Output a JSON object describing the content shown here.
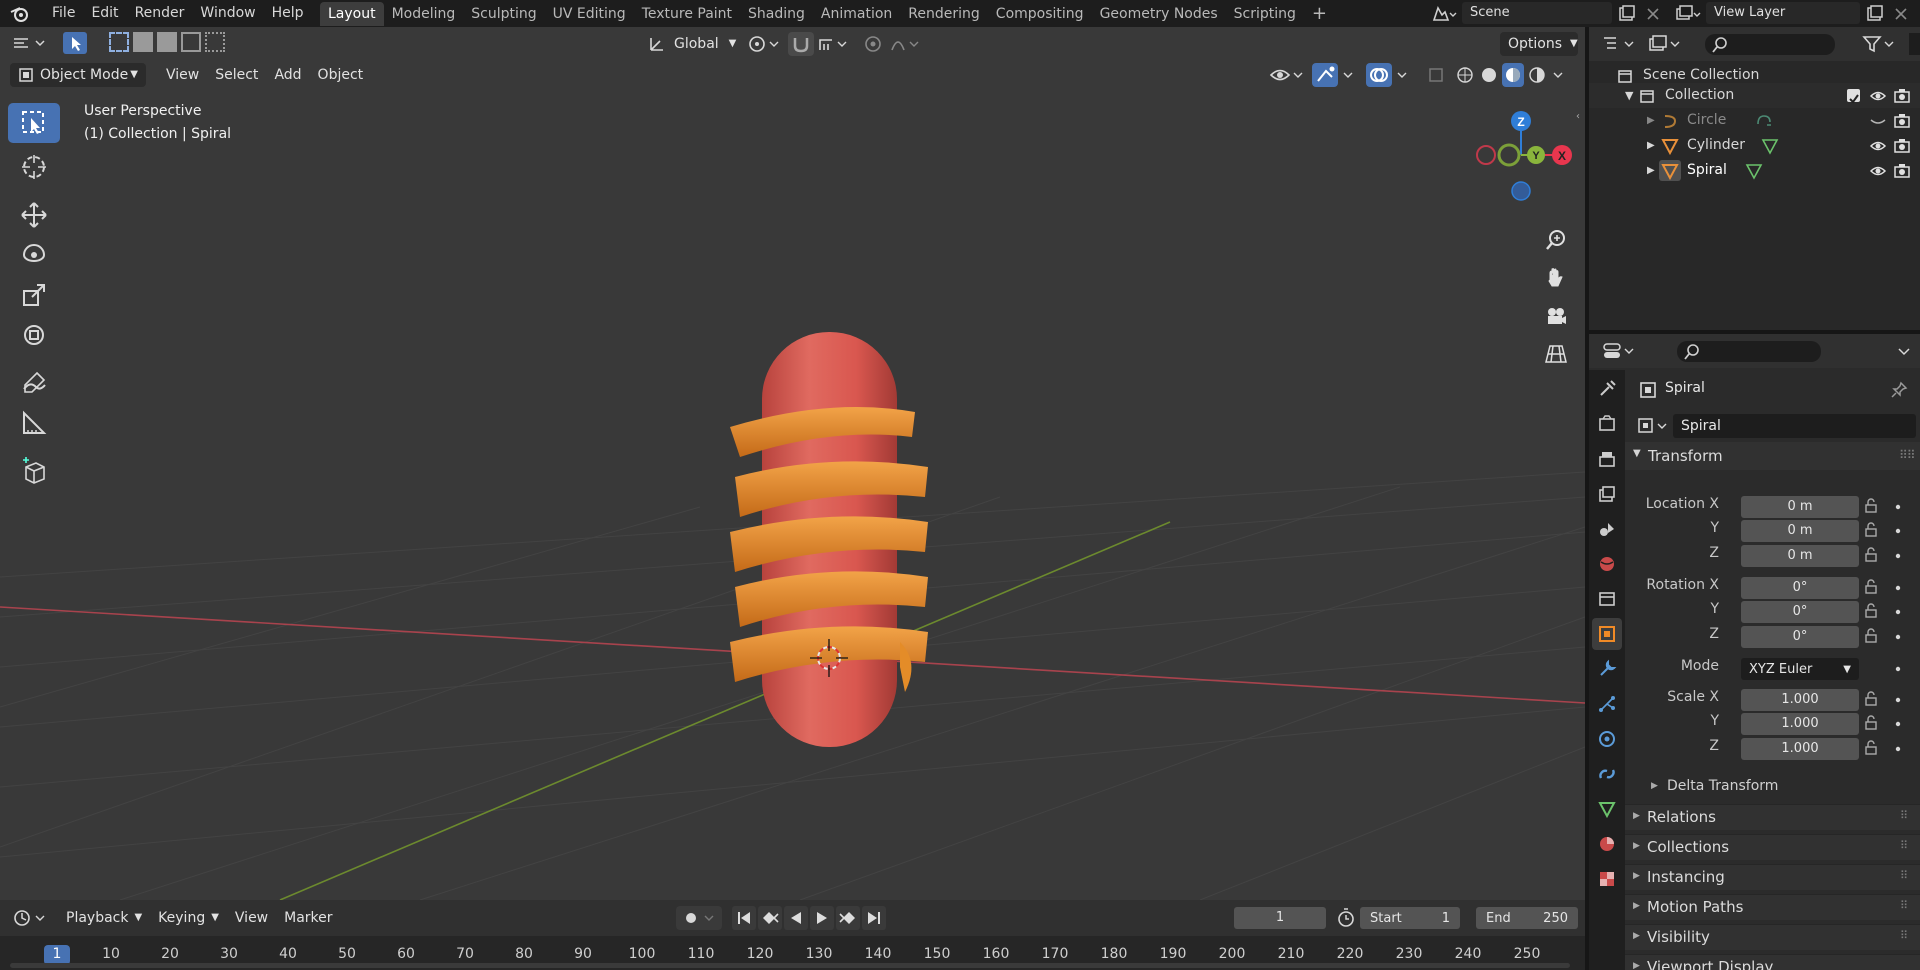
{
  "menu": [
    "File",
    "Edit",
    "Render",
    "Window",
    "Help"
  ],
  "workspaces": [
    {
      "label": "Layout",
      "active": true
    },
    {
      "label": "Modeling"
    },
    {
      "label": "Sculpting"
    },
    {
      "label": "UV Editing"
    },
    {
      "label": "Texture Paint"
    },
    {
      "label": "Shading"
    },
    {
      "label": "Animation"
    },
    {
      "label": "Rendering"
    },
    {
      "label": "Compositing"
    },
    {
      "label": "Geometry Nodes"
    },
    {
      "label": "Scripting"
    }
  ],
  "scene": {
    "name": "Scene"
  },
  "view_layer": {
    "name": "View Layer"
  },
  "viewport": {
    "orientation": "Global",
    "options_label": "Options",
    "mode": "Object Mode",
    "menus": [
      "View",
      "Select",
      "Add",
      "Object"
    ],
    "perspective": "User Perspective",
    "collection_info": "(1) Collection | Spiral",
    "gizmo_axes": {
      "z": "Z",
      "y": "Y",
      "x": "X"
    }
  },
  "outliner": {
    "root": "Scene Collection",
    "collection": "Collection",
    "objects": [
      "Circle",
      "Cylinder",
      "Spiral"
    ]
  },
  "properties": {
    "object_name": "Spiral",
    "data_name": "Spiral",
    "transform_title": "Transform",
    "location_label": "Location X",
    "rotation_label": "Rotation X",
    "scale_label": "Scale X",
    "y_label": "Y",
    "z_label": "Z",
    "location": [
      "0 m",
      "0 m",
      "0 m"
    ],
    "rotation": [
      "0°",
      "0°",
      "0°"
    ],
    "mode_label": "Mode",
    "rotation_mode": "XYZ Euler",
    "scale": [
      "1.000",
      "1.000",
      "1.000"
    ],
    "delta_transform": "Delta Transform",
    "panels": [
      "Relations",
      "Collections",
      "Instancing",
      "Motion Paths",
      "Visibility",
      "Viewport Display"
    ]
  },
  "timeline": {
    "menus": [
      "Playback",
      "Keying",
      "View",
      "Marker"
    ],
    "current_frame": "1",
    "start_label": "Start",
    "start": "1",
    "end_label": "End",
    "end": "250",
    "ruler": [
      "1",
      "10",
      "20",
      "30",
      "40",
      "50",
      "60",
      "70",
      "80",
      "90",
      "100",
      "110",
      "120",
      "130",
      "140",
      "150",
      "160",
      "170",
      "180",
      "190",
      "200",
      "210",
      "220",
      "230",
      "240",
      "250"
    ]
  },
  "colors": {
    "accent": "#4772b3",
    "x_axis": "#e8364e",
    "y_axis": "#8ab53c",
    "z_axis": "#2f7ed8",
    "sausage": "#d85a52",
    "spiral": "#e48c28"
  }
}
